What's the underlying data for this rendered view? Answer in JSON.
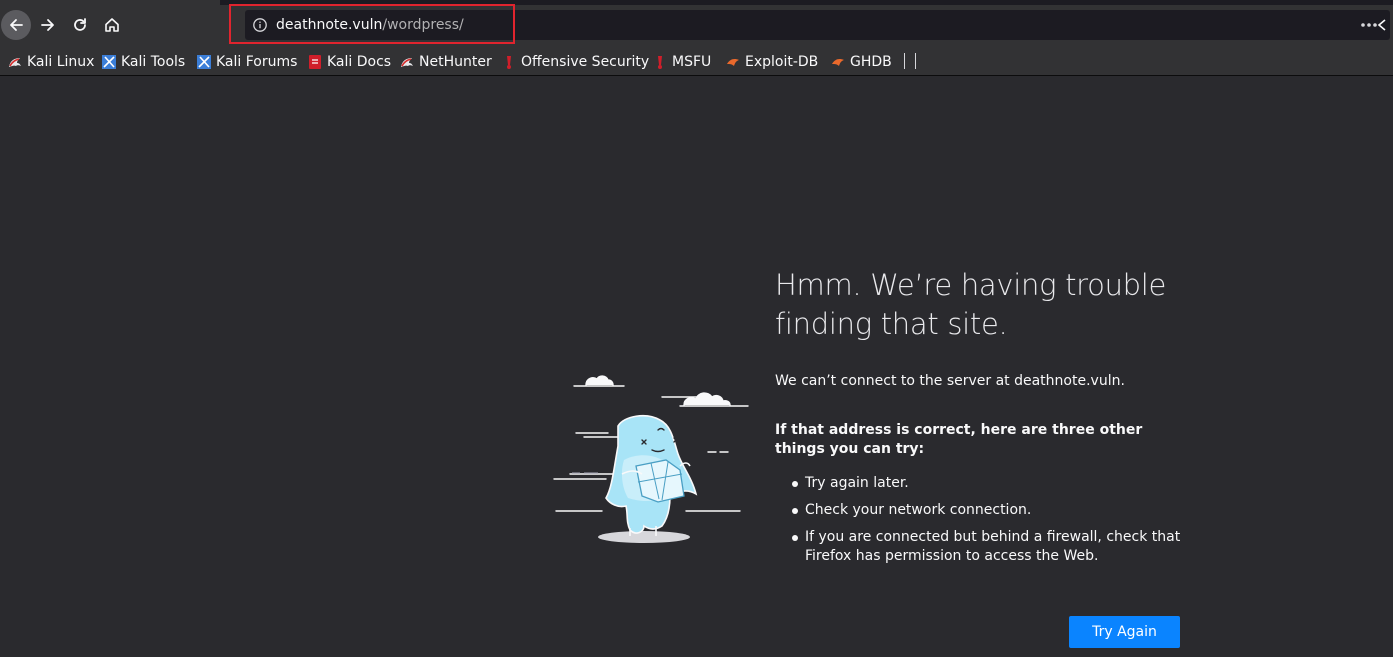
{
  "browser": {
    "url": {
      "host": "deathnote.vuln",
      "path": "/wordpress/"
    },
    "nav_icons": {
      "back": "arrow-left-icon",
      "forward": "arrow-right-icon",
      "reload": "reload-icon",
      "home": "home-icon",
      "site_info": "info-icon",
      "page_actions": "ellipsis-icon"
    },
    "bookmarks": [
      {
        "label": "Kali Linux",
        "icon": "kali-dragon-icon"
      },
      {
        "label": "Kali Tools",
        "icon": "kali-tools-icon"
      },
      {
        "label": "Kali Forums",
        "icon": "kali-forums-icon"
      },
      {
        "label": "Kali Docs",
        "icon": "kali-docs-icon"
      },
      {
        "label": "NetHunter",
        "icon": "nethunter-icon"
      },
      {
        "label": "Offensive Security",
        "icon": "offsec-icon"
      },
      {
        "label": "MSFU",
        "icon": "msfu-icon"
      },
      {
        "label": "Exploit-DB",
        "icon": "exploit-db-icon"
      },
      {
        "label": "GHDB",
        "icon": "ghdb-icon"
      }
    ]
  },
  "error_page": {
    "title": "Hmm. We’re having trouble finding that site.",
    "description": "We can’t connect to the server at deathnote.vuln.",
    "suggestions_heading": "If that address is correct, here are three other things you can try:",
    "suggestions": [
      "Try again later.",
      "Check your network connection.",
      "If you are connected but behind a firewall, check that Firefox has permission to access the Web."
    ],
    "try_again_label": "Try Again",
    "illustration": "confused-dinosaur-illustration"
  },
  "colors": {
    "page_background": "#2a2a2e",
    "toolbar_background": "#323234",
    "urlbar_background": "#1c1b22",
    "accent_button": "#0a84ff",
    "highlight_box": "#e0242e"
  }
}
